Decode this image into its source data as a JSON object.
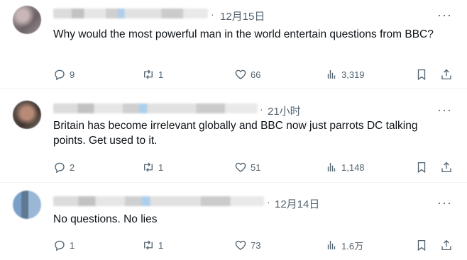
{
  "tweets": [
    {
      "time": "12月15日",
      "text": "Why would the most powerful man in the world entertain questions from BBC?",
      "replies": "9",
      "retweets": "1",
      "likes": "66",
      "views": "3,319"
    },
    {
      "time": "21小时",
      "text": "Britain has become irrelevant globally and BBC now just parrots DC talking points. Get used to it.",
      "replies": "2",
      "retweets": "1",
      "likes": "51",
      "views": "1,148"
    },
    {
      "time": "12月14日",
      "text": "No questions. No lies",
      "replies": "1",
      "retweets": "1",
      "likes": "73",
      "views": "1.6万"
    }
  ],
  "separator": "·",
  "more_glyph": "···",
  "icons": {
    "reply": "reply-icon",
    "retweet": "retweet-icon",
    "like": "heart-icon",
    "views": "analytics-icon",
    "bookmark": "bookmark-icon",
    "share": "share-icon",
    "more": "more-icon"
  },
  "colors": {
    "text": "#0f1419",
    "secondary": "#536471",
    "divider": "#eff3f4"
  }
}
